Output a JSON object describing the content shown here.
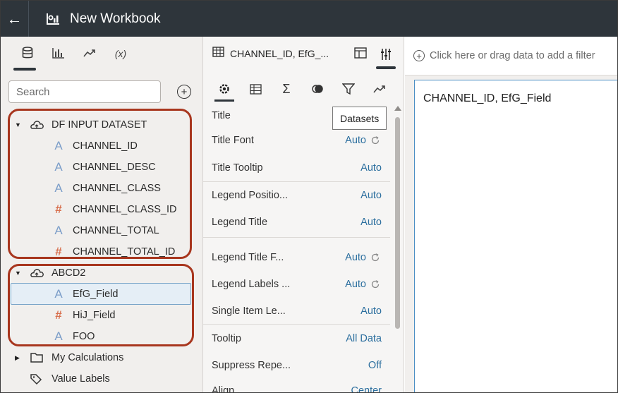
{
  "header": {
    "back_icon": "back-arrow-icon",
    "title": "New Workbook"
  },
  "left_panel": {
    "tabs": [
      "data-icon",
      "visualizations-icon",
      "analytics-icon",
      "calculations-icon"
    ],
    "calc_tab_label": "(x)",
    "search": {
      "placeholder": "Search",
      "value": ""
    },
    "datasets": [
      {
        "name": "DF INPUT DATASET",
        "columns": [
          {
            "type": "A",
            "name": "CHANNEL_ID"
          },
          {
            "type": "A",
            "name": "CHANNEL_DESC"
          },
          {
            "type": "A",
            "name": "CHANNEL_CLASS"
          },
          {
            "type": "#",
            "name": "CHANNEL_CLASS_ID"
          },
          {
            "type": "A",
            "name": "CHANNEL_TOTAL"
          },
          {
            "type": "#",
            "name": "CHANNEL_TOTAL_ID"
          }
        ]
      },
      {
        "name": "ABCD2",
        "columns": [
          {
            "type": "A",
            "name": "EfG_Field"
          },
          {
            "type": "#",
            "name": "HiJ_Field"
          },
          {
            "type": "A",
            "name": "FOO"
          }
        ]
      }
    ],
    "extra_items": [
      "My Calculations",
      "Value Labels"
    ],
    "highlight_color": "#a8361e"
  },
  "middle_panel": {
    "viz_name": "CHANNEL_ID, EfG_...",
    "tooltip": "Datasets",
    "properties": [
      {
        "label": "Title",
        "value": ""
      },
      {
        "label": "Title Font",
        "value": "Auto"
      },
      {
        "label": "Title Tooltip",
        "value": "Auto"
      },
      {
        "label": "Legend Positio...",
        "value": "Auto"
      },
      {
        "label": "Legend Title",
        "value": "Auto"
      },
      {
        "label": "Legend Title F...",
        "value": "Auto"
      },
      {
        "label": "Legend Labels ...",
        "value": "Auto"
      },
      {
        "label": "Single Item Le...",
        "value": "Auto"
      },
      {
        "label": "Tooltip",
        "value": "All Data"
      },
      {
        "label": "Suppress Repe...",
        "value": "Off"
      },
      {
        "label": "Align",
        "value": "Center"
      }
    ]
  },
  "canvas": {
    "filter_placeholder": "Click here or drag data to add a filter",
    "viz_title": "CHANNEL_ID, EfG_Field"
  }
}
